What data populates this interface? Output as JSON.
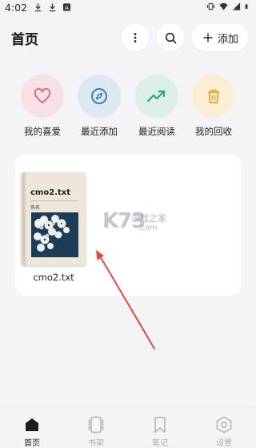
{
  "status_bar": {
    "time": "4:02",
    "left_icons": [
      "download-icon",
      "download-icon",
      "app-notification-icon"
    ],
    "right_icons": [
      "vibrate-icon",
      "wifi-icon",
      "signal-icon",
      "battery-icon"
    ]
  },
  "header": {
    "title": "首页",
    "more_icon": "more-vertical-icon",
    "search_icon": "search-icon",
    "add_label": "添加"
  },
  "quick_actions": [
    {
      "label": "我的喜爱",
      "icon": "heart-icon",
      "bg": "#f6e1e5",
      "color": "#e0607a"
    },
    {
      "label": "最近添加",
      "icon": "compass-icon",
      "bg": "#dde9f1",
      "color": "#3f7fb3"
    },
    {
      "label": "最近阅读",
      "icon": "trending-up-icon",
      "bg": "#dcf0e8",
      "color": "#2fa57c"
    },
    {
      "label": "我的回收",
      "icon": "trash-icon",
      "bg": "#fbeed6",
      "color": "#e3a52a"
    }
  ],
  "books": [
    {
      "name": "cmo2.txt",
      "cover_title": "cmo2.txt",
      "cover_author": "佚名"
    }
  ],
  "watermark": {
    "logo": "K73",
    "cn": "游戏之家",
    "com": ".com"
  },
  "bottom_nav": [
    {
      "label": "首页",
      "icon": "home-icon",
      "active": true
    },
    {
      "label": "书架",
      "icon": "bookshelf-icon",
      "active": false
    },
    {
      "label": "笔记",
      "icon": "bookmark-icon",
      "active": false
    },
    {
      "label": "设置",
      "icon": "settings-hexagon-icon",
      "active": false
    }
  ],
  "colors": {
    "background": "#f4f4f8",
    "card": "#ffffff",
    "arrow": "#e04a3a"
  }
}
